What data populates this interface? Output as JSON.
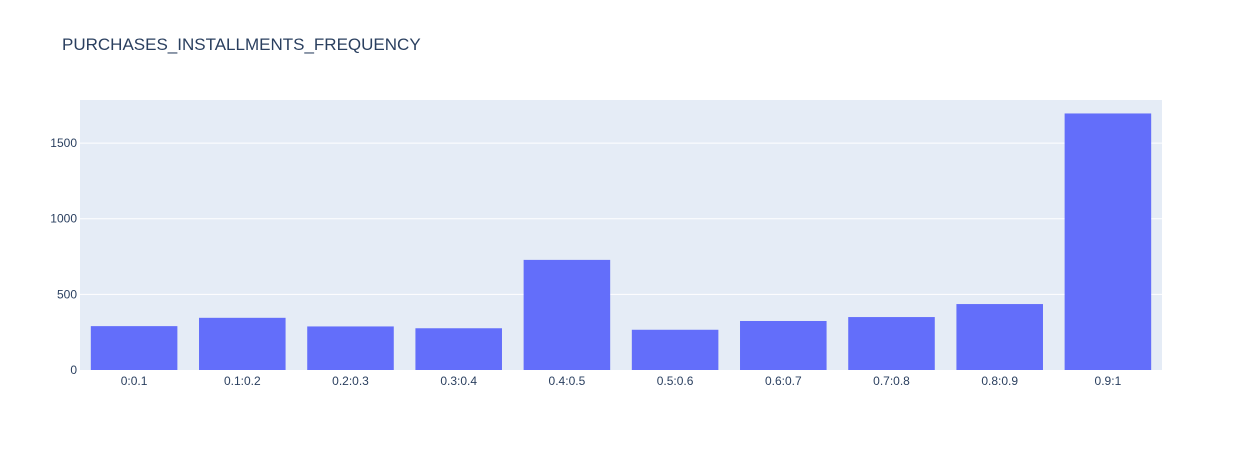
{
  "chart_data": {
    "type": "bar",
    "title": "PURCHASES_INSTALLMENTS_FREQUENCY",
    "xlabel": "",
    "ylabel": "",
    "categories": [
      "0:0.1",
      "0.1:0.2",
      "0.2:0.3",
      "0.3:0.4",
      "0.4:0.5",
      "0.5:0.6",
      "0.6:0.7",
      "0.7:0.8",
      "0.8:0.9",
      "0.9:1"
    ],
    "values": [
      290,
      345,
      288,
      276,
      728,
      266,
      324,
      350,
      436,
      1696
    ],
    "ylim": [
      0,
      1785
    ],
    "yticks": [
      0,
      500,
      1000,
      1500
    ],
    "grid": true,
    "legend": "none",
    "colors": {
      "bar": "#636efa",
      "plot_background": "#e5ecf6",
      "text": "#2a3f5f"
    }
  }
}
